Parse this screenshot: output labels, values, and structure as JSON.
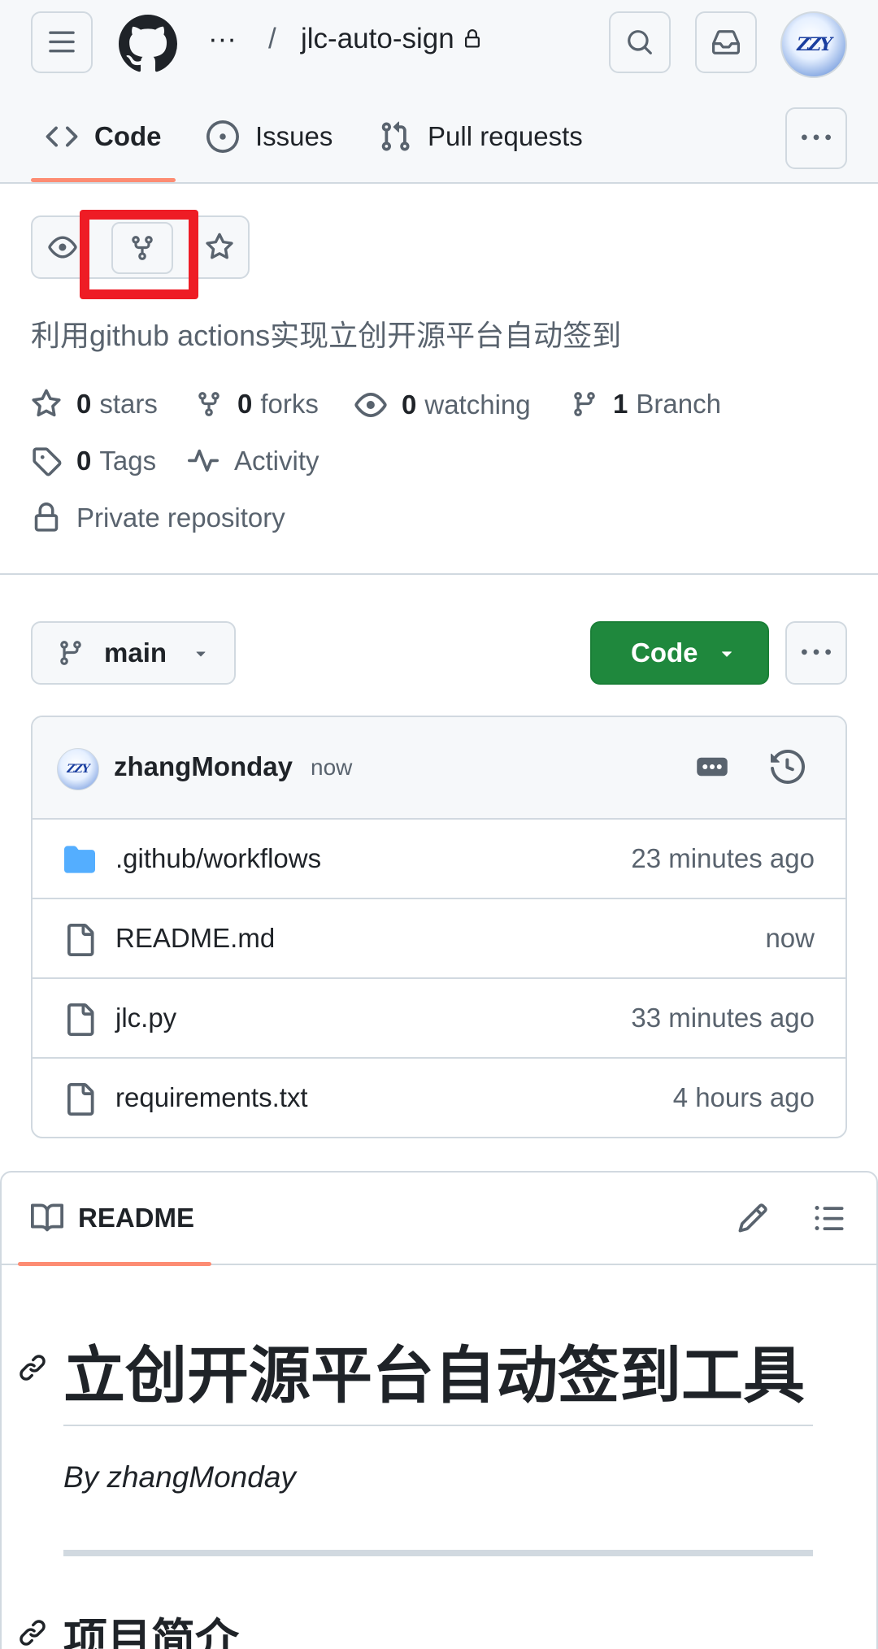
{
  "header": {
    "breadcrumb_ellipsis": "···",
    "breadcrumb_sep": "/",
    "repo_name": "jlc-auto-sign",
    "avatar_text": "ZZY",
    "tabs": [
      {
        "label": "Code",
        "icon": "code-icon"
      },
      {
        "label": "Issues",
        "icon": "issue-opened-icon"
      },
      {
        "label": "Pull requests",
        "icon": "git-pull-request-icon"
      }
    ]
  },
  "repo": {
    "description": "利用github actions实现立创开源平台自动签到",
    "stats": {
      "stars_count": "0",
      "stars_label": "stars",
      "forks_count": "0",
      "forks_label": "forks",
      "watching_count": "0",
      "watching_label": "watching",
      "branch_count": "1",
      "branch_label": "Branch",
      "tags_count": "0",
      "tags_label": "Tags",
      "activity_label": "Activity",
      "visibility_label": "Private repository"
    }
  },
  "toolbar": {
    "branch": "main",
    "code_button": "Code"
  },
  "commit": {
    "user": "zhangMonday",
    "time": "now",
    "avatar_text": "ZZY"
  },
  "files": [
    {
      "name": ".github/workflows",
      "type": "folder",
      "time": "23 minutes ago"
    },
    {
      "name": "README.md",
      "type": "file",
      "time": "now"
    },
    {
      "name": "jlc.py",
      "type": "file",
      "time": "33 minutes ago"
    },
    {
      "name": "requirements.txt",
      "type": "file",
      "time": "4 hours ago"
    }
  ],
  "readme": {
    "tab_label": "README",
    "title": "立创开源平台自动签到工具",
    "byline": "By zhangMonday",
    "section_heading": "项目简介"
  },
  "colors": {
    "accent_underline": "#fd8c73",
    "code_button": "#1f883d",
    "highlight_box": "#ee1c25",
    "folder": "#54aeff"
  }
}
